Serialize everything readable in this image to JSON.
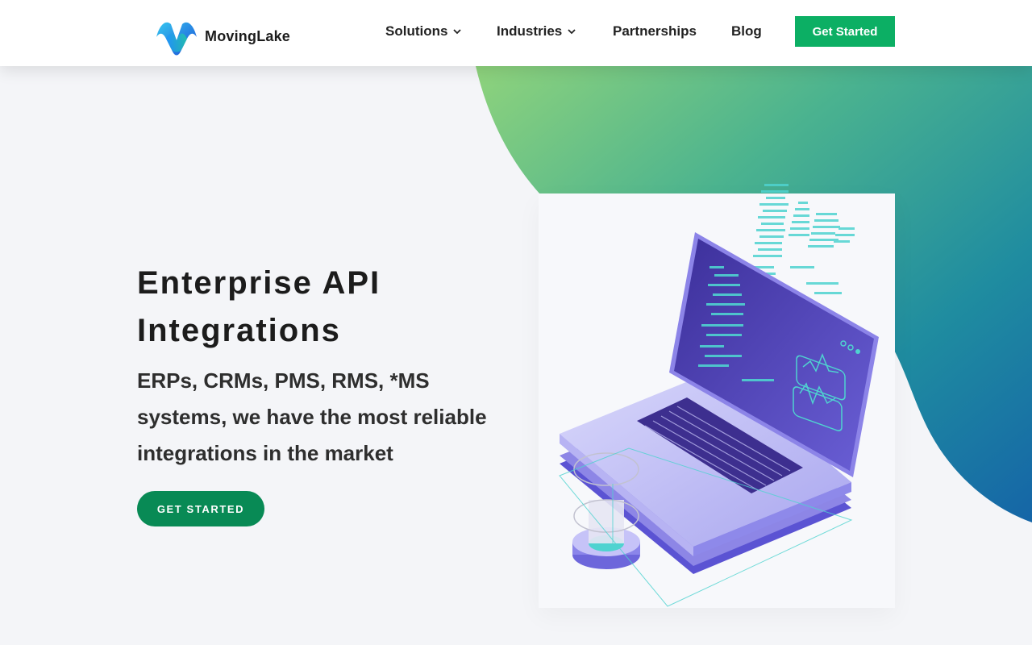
{
  "brand": {
    "name": "MovingLake",
    "logo_icon": "movinglake-logo-icon"
  },
  "nav": {
    "items": [
      {
        "label": "Solutions",
        "has_dropdown": true
      },
      {
        "label": "Industries",
        "has_dropdown": true
      },
      {
        "label": "Partnerships",
        "has_dropdown": false
      },
      {
        "label": "Blog",
        "has_dropdown": false
      }
    ],
    "cta_label": "Get Started"
  },
  "hero": {
    "title_line1": "Enterprise API",
    "title_line2": "Integrations",
    "subtitle_line1": "ERPs, CRMs, PMS, RMS, *MS",
    "subtitle_line2": "systems, we have the most reliable",
    "subtitle_line3": "integrations in the market",
    "button_label": "GET STARTED"
  },
  "colors": {
    "header_cta": "#0caf64",
    "hero_button": "#088a55",
    "blob_start": "#8bd07a",
    "blob_end": "#1666a8",
    "background": "#f4f5f8"
  }
}
